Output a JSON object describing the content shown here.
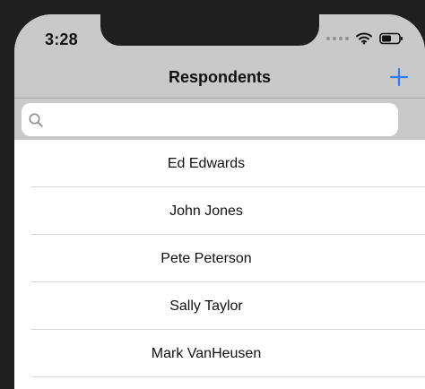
{
  "status_bar": {
    "time": "3:28"
  },
  "navigation": {
    "title": "Respondents",
    "add_icon": "plus-icon"
  },
  "search": {
    "placeholder": "",
    "value": "",
    "icon": "search-icon"
  },
  "respondents": [
    "Ed Edwards",
    "John Jones",
    "Pete Peterson",
    "Sally Taylor",
    "Mark VanHeusen"
  ],
  "colors": {
    "nav_background": "#c9c9c9",
    "accent": "#2f7cf6",
    "frame": "#1f1f1f"
  }
}
